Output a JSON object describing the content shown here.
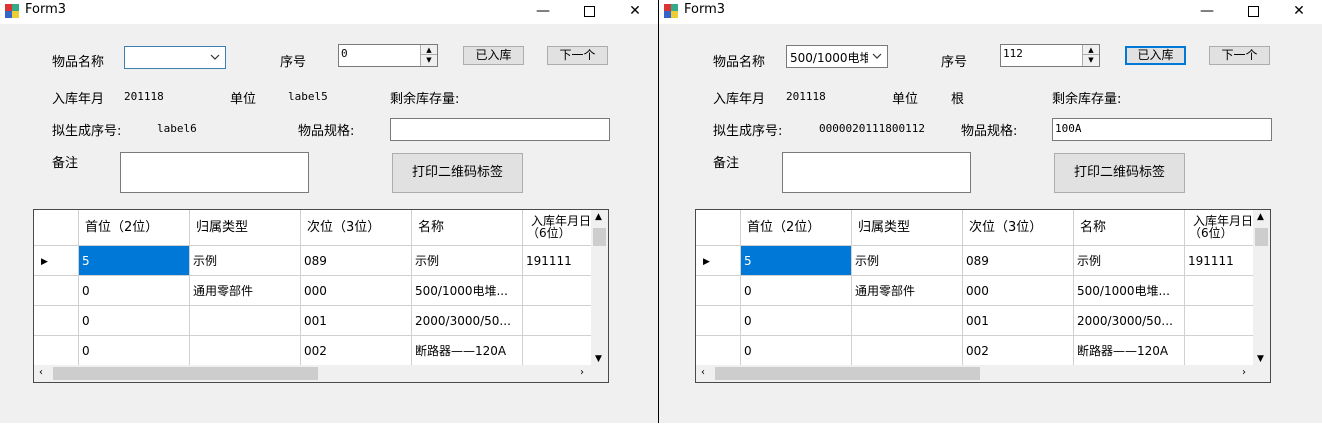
{
  "windows": [
    {
      "title": "Form3",
      "item_name_label": "物品名称",
      "item_name_value": "",
      "seq_label": "序号",
      "seq_value": "0",
      "stored_button": "已入库",
      "next_button": "下一个",
      "stock_date_label": "入库年月",
      "stock_date_value": "201118",
      "unit_label": "单位",
      "unit_value": "label5",
      "remaining_label": "剩余库存量:",
      "proposed_seq_label": "拟生成序号:",
      "proposed_seq_value": "label6",
      "spec_label": "物品规格:",
      "spec_value": "",
      "remark_label": "备注",
      "remark_value": "",
      "print_button": "打印二维码标签",
      "grid": {
        "columns": [
          "首位（2位）",
          "归属类型",
          "次位（3位）",
          "名称",
          "入库年月日",
          "（6位）"
        ],
        "rows": [
          [
            "5",
            "示例",
            "089",
            "示例",
            "191111"
          ],
          [
            "0",
            "通用零部件",
            "000",
            "500/1000电堆...",
            ""
          ],
          [
            "0",
            "",
            "001",
            "2000/3000/50...",
            ""
          ],
          [
            "0",
            "",
            "002",
            "断路器——120A",
            ""
          ]
        ]
      }
    },
    {
      "title": "Form3",
      "item_name_label": "物品名称",
      "item_name_value": "500/1000电堆",
      "seq_label": "序号",
      "seq_value": "112",
      "stored_button": "已入库",
      "next_button": "下一个",
      "stock_date_label": "入库年月",
      "stock_date_value": "201118",
      "unit_label": "单位",
      "unit_value": "根",
      "remaining_label": "剩余库存量:",
      "proposed_seq_label": "拟生成序号:",
      "proposed_seq_value": "0000020111800112",
      "spec_label": "物品规格:",
      "spec_value": "100A",
      "remark_label": "备注",
      "remark_value": "",
      "print_button": "打印二维码标签",
      "grid": {
        "columns": [
          "首位（2位）",
          "归属类型",
          "次位（3位）",
          "名称",
          "入库年月日",
          "（6位）"
        ],
        "rows": [
          [
            "5",
            "示例",
            "089",
            "示例",
            "191111"
          ],
          [
            "0",
            "通用零部件",
            "000",
            "500/1000电堆...",
            ""
          ],
          [
            "0",
            "",
            "001",
            "2000/3000/50...",
            ""
          ],
          [
            "0",
            "",
            "002",
            "断路器——120A",
            ""
          ]
        ]
      }
    }
  ],
  "colors": {
    "selection": "#0078d7",
    "window_bg": "#f0f0f0",
    "button_bg": "#e1e1e1"
  },
  "icons": {
    "app_icon": "winforms-app-icon",
    "minimize": "minimize-icon",
    "maximize": "maximize-icon",
    "close": "close-icon",
    "dropdown": "chevron-down-icon",
    "row_pointer": "row-pointer-icon"
  }
}
